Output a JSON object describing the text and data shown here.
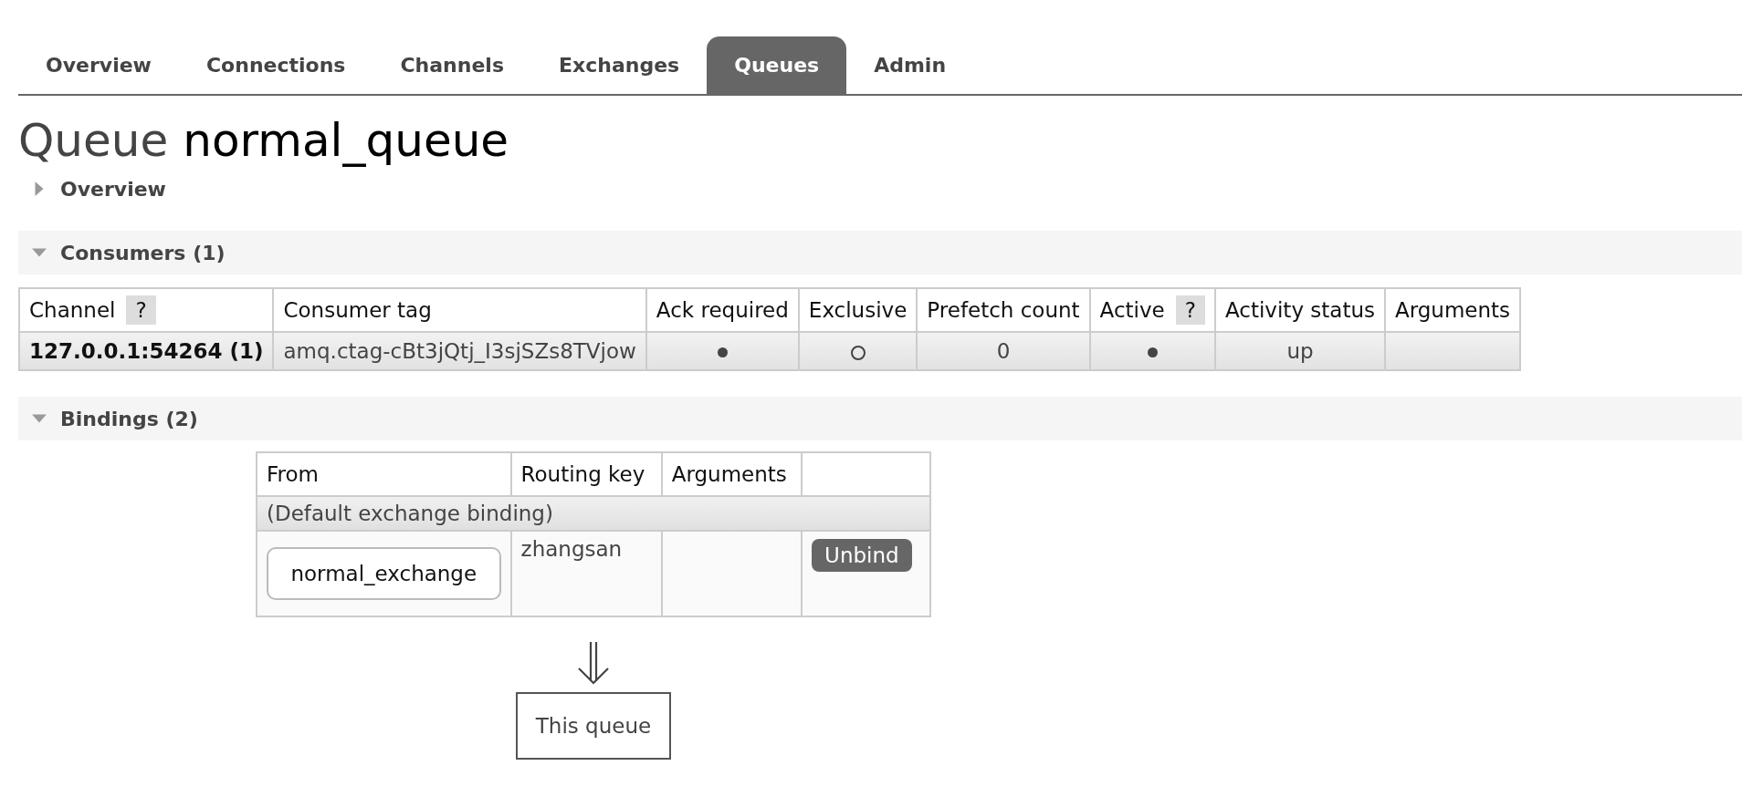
{
  "tabs": [
    {
      "label": "Overview",
      "selected": false
    },
    {
      "label": "Connections",
      "selected": false
    },
    {
      "label": "Channels",
      "selected": false
    },
    {
      "label": "Exchanges",
      "selected": false
    },
    {
      "label": "Queues",
      "selected": true
    },
    {
      "label": "Admin",
      "selected": false
    }
  ],
  "title": {
    "kind_label": "Queue",
    "name": "normal_queue"
  },
  "overview": {
    "label": "Overview",
    "expanded": false
  },
  "consumers": {
    "label": "Consumers (1)",
    "expanded": true,
    "columns": [
      {
        "label": "Channel",
        "help": "?"
      },
      {
        "label": "Consumer tag"
      },
      {
        "label": "Ack required"
      },
      {
        "label": "Exclusive"
      },
      {
        "label": "Prefetch count"
      },
      {
        "label": "Active",
        "help": "?"
      },
      {
        "label": "Activity status"
      },
      {
        "label": "Arguments"
      }
    ],
    "rows": [
      {
        "channel": "127.0.0.1:54264 (1)",
        "consumer_tag": "amq.ctag-cBt3jQtj_I3sjSZs8TVjow",
        "ack_required": true,
        "exclusive": false,
        "prefetch_count": "0",
        "active": true,
        "activity_status": "up"
      }
    ]
  },
  "bindings": {
    "label": "Bindings (2)",
    "expanded": true,
    "columns": [
      "From",
      "Routing key",
      "Arguments"
    ],
    "default_row": "(Default exchange binding)",
    "rows": [
      {
        "from": "normal_exchange",
        "routing_key": "zhangsan",
        "action": "Unbind"
      }
    ],
    "target": "This queue"
  }
}
